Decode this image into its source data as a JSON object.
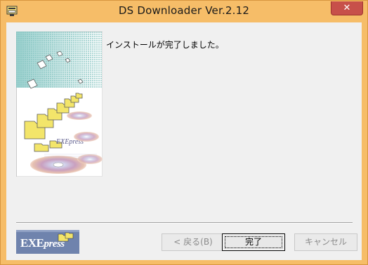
{
  "window": {
    "title": "DS Downloader Ver.2.12",
    "close_label": "✕"
  },
  "icons": {
    "app": "installer-icon",
    "close": "close-icon"
  },
  "content": {
    "message": "インストールが完了しました。"
  },
  "artwork": {
    "watermark_text": "EXEpress"
  },
  "logo": {
    "text_main": "EXE",
    "text_sub": "press"
  },
  "buttons": {
    "back": "< 戻る(B)",
    "finish": "完了",
    "cancel": "キャンセル"
  },
  "colors": {
    "frame": "#f6bd68",
    "close": "#c7504a",
    "logo_bg": "#6b7fa8",
    "folder": "#f3e56a"
  }
}
